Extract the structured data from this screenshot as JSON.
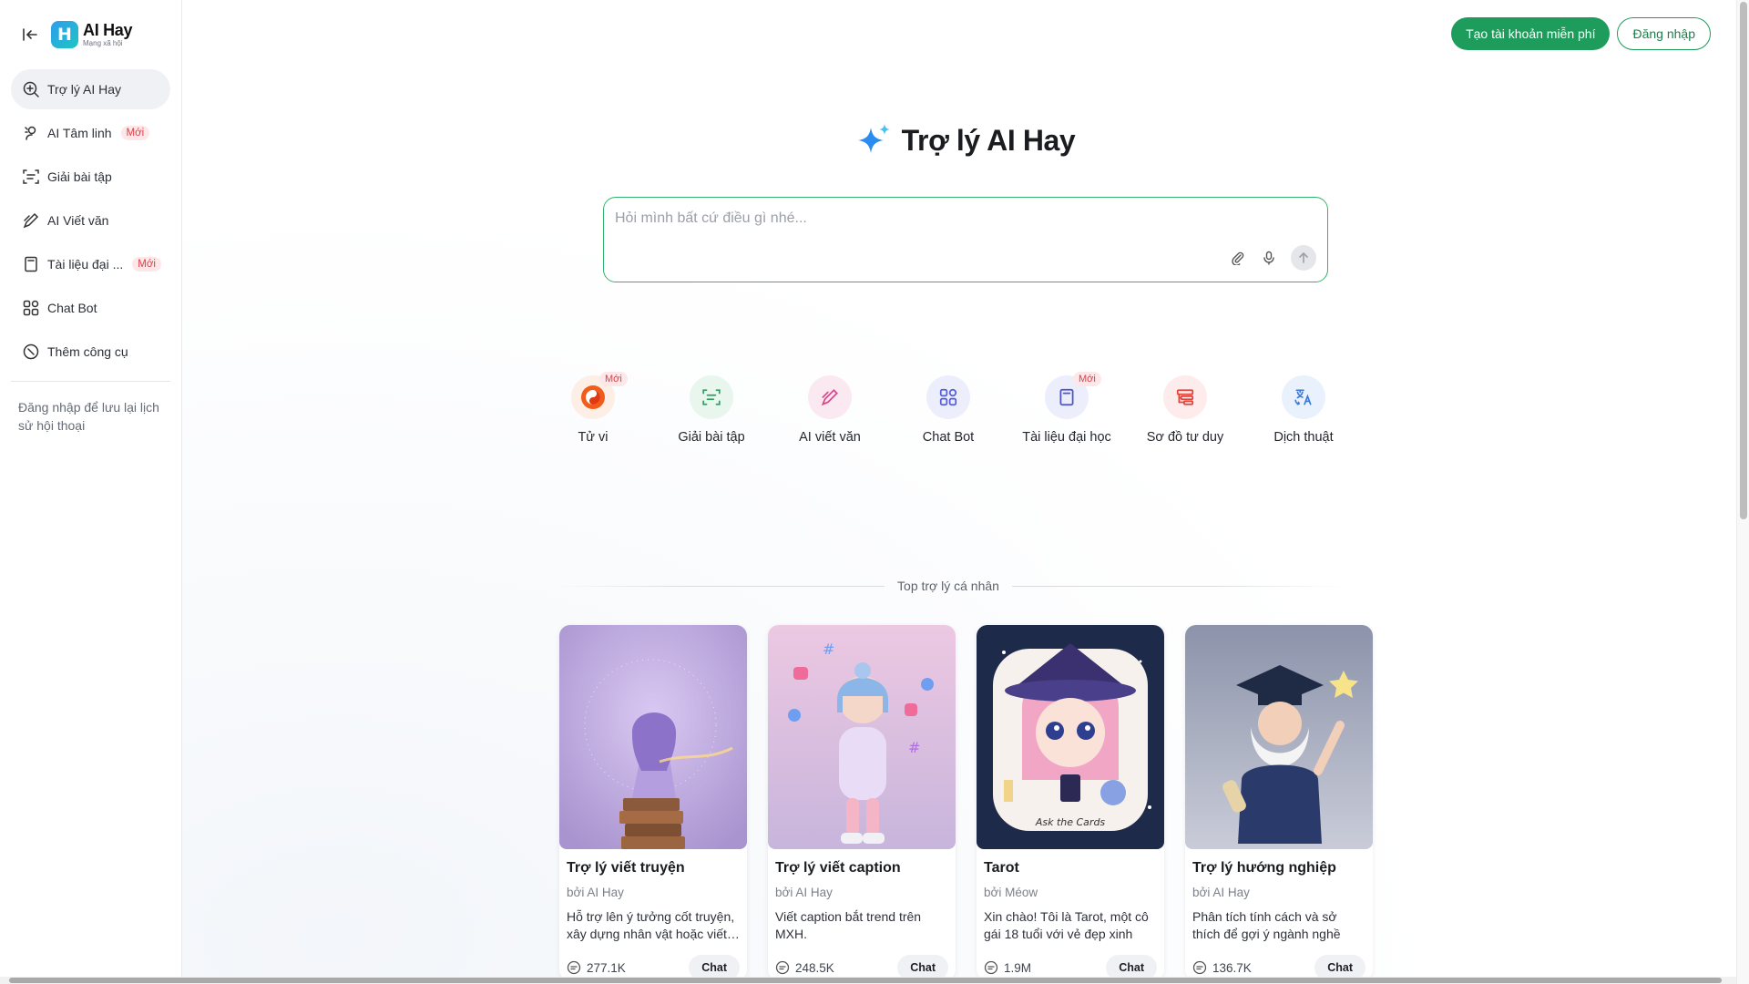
{
  "app": {
    "logo_title": "AI Hay",
    "logo_subtitle": "Mạng xã hội"
  },
  "sidebar": {
    "items": [
      {
        "label": "Trợ lý AI Hay",
        "icon": "search-sparkle-icon",
        "active": true
      },
      {
        "label": "AI Tâm linh",
        "icon": "spirit-icon",
        "badge": "Mới"
      },
      {
        "label": "Giải bài tập",
        "icon": "scan-icon"
      },
      {
        "label": "AI Viết văn",
        "icon": "pen-icon"
      },
      {
        "label": "Tài liệu đại ...",
        "icon": "book-icon",
        "badge": "Mới"
      },
      {
        "label": "Chat Bot",
        "icon": "grid-icon"
      },
      {
        "label": "Thêm công cụ",
        "icon": "compass-icon"
      }
    ],
    "login_hint": "Đăng nhập để lưu lại lịch sử hội thoại"
  },
  "header": {
    "signup_label": "Tạo tài khoản miễn phí",
    "login_label": "Đăng nhập"
  },
  "hero": {
    "title": "Trợ lý AI Hay"
  },
  "composer": {
    "placeholder": "Hỏi mình bất cứ điều gì nhé..."
  },
  "features": [
    {
      "label": "Tử vi",
      "badge": "Mới",
      "icon": "yin-yang-icon",
      "bg": "#fdeee6",
      "color": "#e8541a"
    },
    {
      "label": "Giải bài tập",
      "icon": "scan-icon",
      "bg": "#e9f6ee",
      "color": "#2ea062"
    },
    {
      "label": "AI viết văn",
      "icon": "pen-icon",
      "bg": "#fbe9f1",
      "color": "#d64b8c"
    },
    {
      "label": "Chat Bot",
      "icon": "grid-icon",
      "bg": "#eceefb",
      "color": "#5560d8"
    },
    {
      "label": "Tài liệu đại học",
      "badge": "Mới",
      "icon": "book-icon",
      "bg": "#eceefb",
      "color": "#4a56c9"
    },
    {
      "label": "Sơ đồ tư duy",
      "icon": "mindmap-icon",
      "bg": "#fdeceb",
      "color": "#e0453c"
    },
    {
      "label": "Dịch thuật",
      "icon": "translate-icon",
      "bg": "#e9f1fd",
      "color": "#3a79d9"
    }
  ],
  "section": {
    "title": "Top trợ lý cá nhân"
  },
  "cards": [
    {
      "title": "Trợ lý viết truyện",
      "author": "bởi AI Hay",
      "desc": "Hỗ trợ lên ý tưởng cốt truyện, xây dựng nhân vật hoặc viết…",
      "count": "277.1K",
      "chat": "Chat"
    },
    {
      "title": "Trợ lý viết caption",
      "author": "bởi AI Hay",
      "desc": "Viết caption bắt trend trên MXH.",
      "count": "248.5K",
      "chat": "Chat"
    },
    {
      "title": "Tarot",
      "author": "bởi Méow",
      "desc": "Xin chào! Tôi là Tarot, một cô gái 18 tuổi với vẻ đẹp xinh xă…",
      "count": "1.9M",
      "chat": "Chat",
      "image_caption": "Ask the Cards"
    },
    {
      "title": "Trợ lý hướng nghiệp",
      "author": "bởi AI Hay",
      "desc": "Phân tích tính cách và sở thích để gợi ý ngành nghề ph…",
      "count": "136.7K",
      "chat": "Chat"
    }
  ],
  "colors": {
    "accent": "#1e9c5b",
    "badge_bg": "#fde7e8",
    "badge_text": "#e23b46"
  }
}
